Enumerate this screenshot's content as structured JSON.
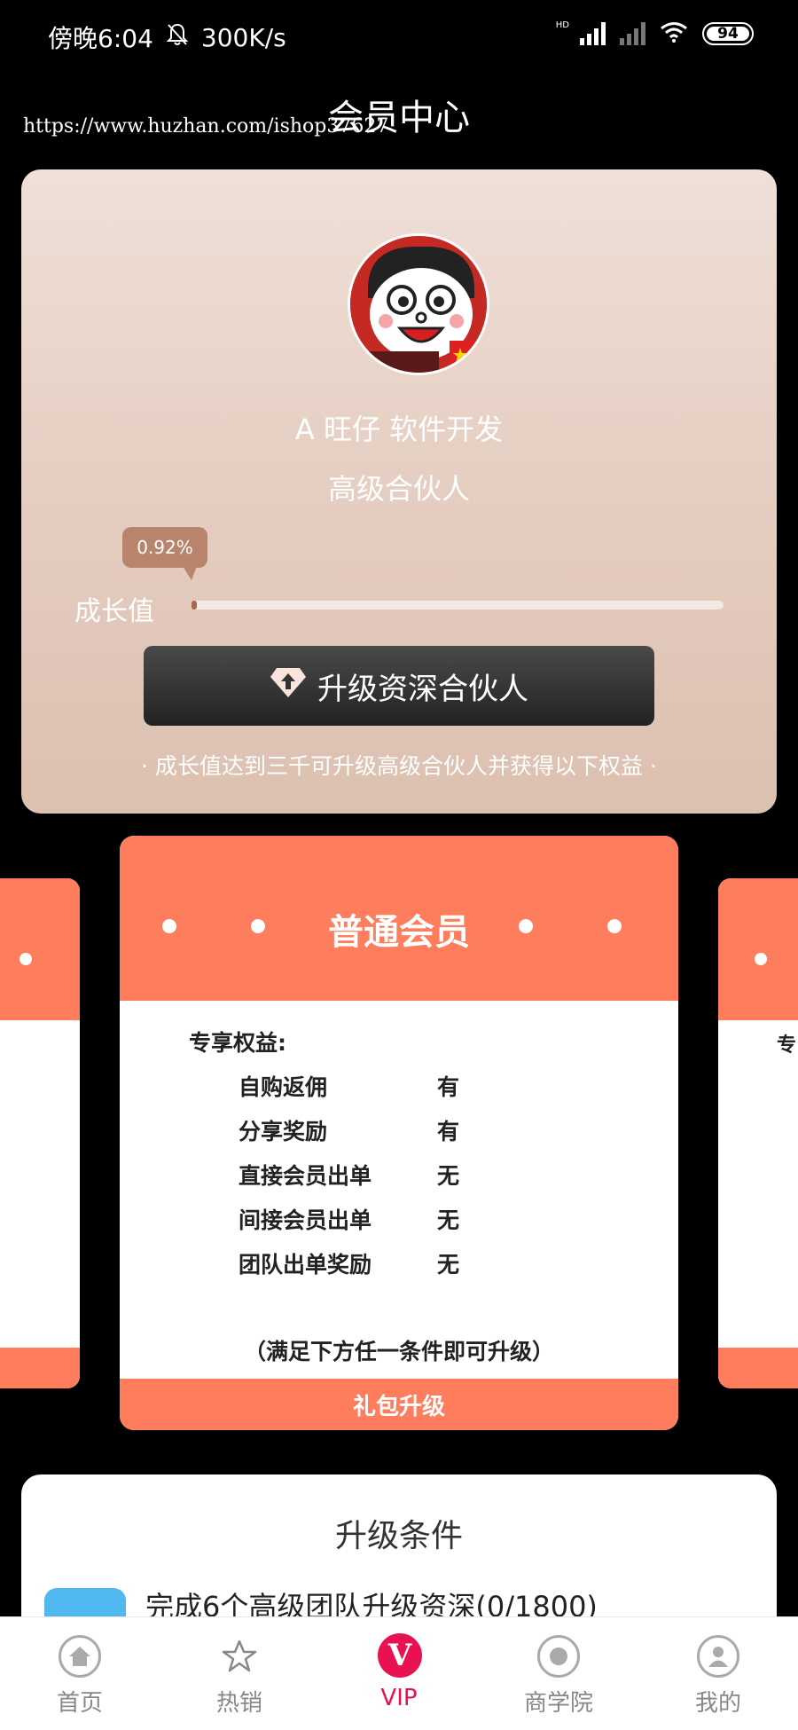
{
  "status_bar": {
    "time": "傍晚6:04",
    "speed": "300K/s",
    "battery": "94",
    "hd_label": "HD"
  },
  "header": {
    "title": "会员中心",
    "watermark": "https://www.huzhan.com/ishop37627"
  },
  "profile": {
    "name": "A 旺仔 软件开发",
    "level": "高级合伙人",
    "growth_label": "成长值",
    "growth_percent_text": "0.92%",
    "growth_fraction": 0.0092,
    "upgrade_button": "升级资深合伙人",
    "upgrade_note": "· 成长值达到三千可升级高级合伙人并获得以下权益 ·"
  },
  "membership_card": {
    "title": "普通会员",
    "benefit_title": "专享权益:",
    "benefits": [
      {
        "name": "自购返佣",
        "value": "有"
      },
      {
        "name": "分享奖励",
        "value": "有"
      },
      {
        "name": "直接会员出单",
        "value": "无"
      },
      {
        "name": "间接会员出单",
        "value": "无"
      },
      {
        "name": "团队出单奖励",
        "value": "无"
      }
    ],
    "condition_note": "（满足下方任一条件即可升级）",
    "gift_button": "礼包升级",
    "accent_color": "#fe7d5c"
  },
  "side_card_peek": "专",
  "conditions": {
    "title": "升级条件",
    "items": [
      {
        "text": "完成6个高级团队升级资深(0/1800)"
      }
    ]
  },
  "bottom_nav": {
    "items": [
      {
        "label": "首页",
        "icon": "home-icon"
      },
      {
        "label": "热销",
        "icon": "star-icon"
      },
      {
        "label": "VIP",
        "icon": "vip-icon"
      },
      {
        "label": "商学院",
        "icon": "record-icon"
      },
      {
        "label": "我的",
        "icon": "person-icon"
      }
    ],
    "active_color": "#e7124f"
  }
}
